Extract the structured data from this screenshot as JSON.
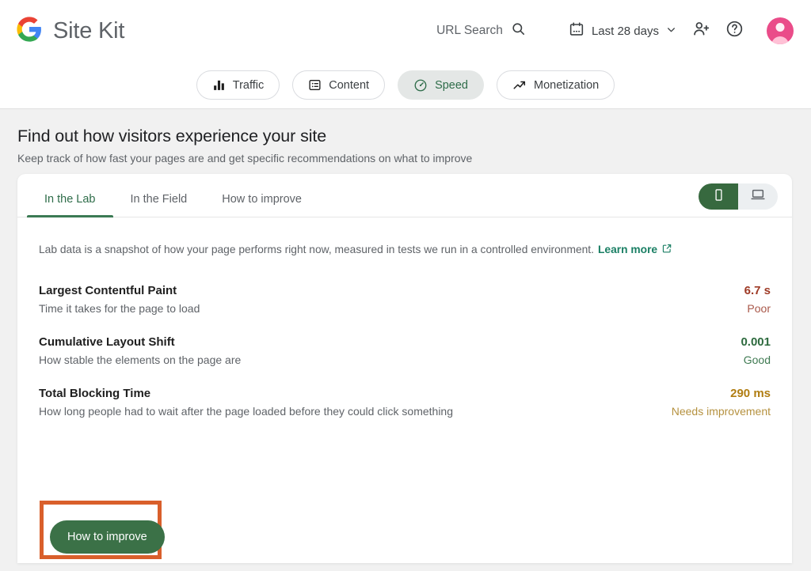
{
  "header": {
    "brand_first": "Site",
    "brand_second": "Kit",
    "logo_icon": "google-g-icon",
    "url_search_label": "URL Search",
    "search_icon": "search-icon",
    "date_range_label": "Last 28 days",
    "calendar_icon": "calendar-icon",
    "chevron_icon": "chevron-down-icon",
    "add_user_icon": "person-add-icon",
    "help_icon": "help-circle-icon",
    "avatar_icon": "user-avatar",
    "avatar_color": "#ea4c89"
  },
  "nav": {
    "items": [
      {
        "label": "Traffic",
        "icon": "bar-chart-icon",
        "selected": false
      },
      {
        "label": "Content",
        "icon": "list-box-icon",
        "selected": false
      },
      {
        "label": "Speed",
        "icon": "speedometer-icon",
        "selected": true
      },
      {
        "label": "Monetization",
        "icon": "trending-up-icon",
        "selected": false
      }
    ],
    "selected_color": "#2f6d4a",
    "selected_bg": "#e4e7e6"
  },
  "page": {
    "title": "Find out how visitors experience your site",
    "subtitle": "Keep track of how fast your pages are and get specific recommendations on what to improve"
  },
  "card": {
    "tabs": [
      {
        "label": "In the Lab",
        "active": true
      },
      {
        "label": "In the Field",
        "active": false
      },
      {
        "label": "How to improve",
        "active": false
      }
    ],
    "active_tab_color": "#2f6d4a",
    "device_toggle": {
      "mobile_icon": "mobile-phone-icon",
      "desktop_icon": "laptop-icon",
      "selected": "mobile",
      "selected_bg": "#37693f"
    },
    "lab_note": {
      "text": "Lab data is a snapshot of how your page performs right now, measured in tests we run in a controlled environment.",
      "link_label": "Learn more",
      "link_icon": "external-link-icon",
      "link_color": "#1a7f64"
    },
    "metrics": [
      {
        "title": "Largest Contentful Paint",
        "description": "Time it takes for the page to load",
        "value": "6.7 s",
        "status": "Poor",
        "value_color": "#9e3a25",
        "status_color": "#a9584a"
      },
      {
        "title": "Cumulative Layout Shift",
        "description": "How stable the elements on the page are",
        "value": "0.001",
        "status": "Good",
        "value_color": "#2d6a3e",
        "status_color": "#3f7a52"
      },
      {
        "title": "Total Blocking Time",
        "description": "How long people had to wait after the page loaded before they could click something",
        "value": "290 ms",
        "status": "Needs improvement",
        "value_color": "#b07d12",
        "status_color": "#b5913f"
      }
    ],
    "cta": {
      "label": "How to improve",
      "bg_color": "#3b7147",
      "highlight_color": "#d95f2b"
    }
  }
}
